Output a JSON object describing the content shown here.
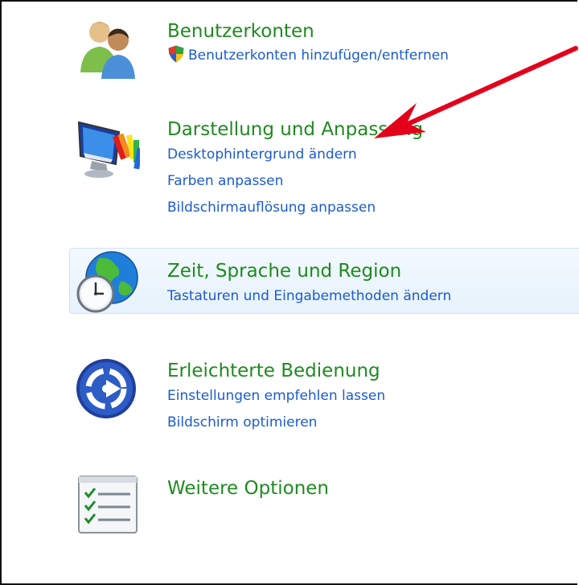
{
  "categories": [
    {
      "title": "Benutzerkonten",
      "icon": "users-icon",
      "links": [
        "Benutzerkonten hinzufügen/entfernen"
      ],
      "first_link_shield": true
    },
    {
      "title": "Darstellung und Anpassung",
      "icon": "appearance-icon",
      "links": [
        "Desktophintergrund ändern",
        "Farben anpassen",
        "Bildschirmauflösung anpassen"
      ]
    },
    {
      "title": "Zeit, Sprache und Region",
      "icon": "clock-globe-icon",
      "links": [
        "Tastaturen und Eingabemethoden ändern"
      ],
      "highlighted": true
    },
    {
      "title": "Erleichterte Bedienung",
      "icon": "ease-of-access-icon",
      "links": [
        "Einstellungen empfehlen lassen",
        "Bildschirm optimieren"
      ]
    },
    {
      "title": "Weitere Optionen",
      "icon": "checklist-icon",
      "links": []
    }
  ],
  "colors": {
    "title": "#1f8a1f",
    "link": "#1b5bcf",
    "annotation_arrow": "#e3001b"
  }
}
